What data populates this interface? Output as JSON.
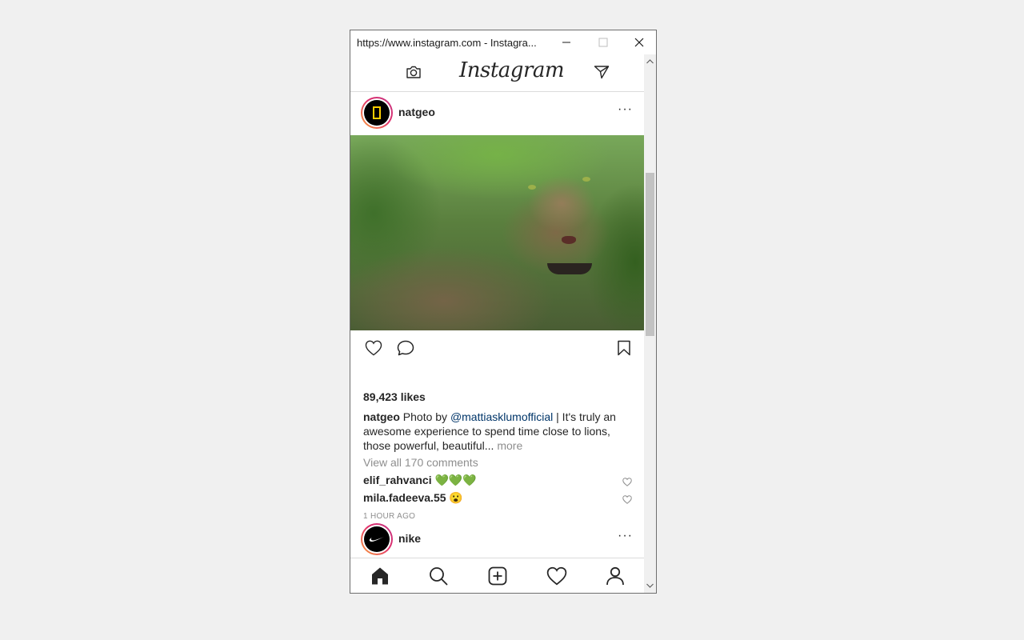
{
  "window": {
    "title": "https://www.instagram.com - Instagra...",
    "min_label": "–",
    "max_label": "□",
    "close_label": "✕"
  },
  "header": {
    "logo": "Instagram"
  },
  "post": {
    "username": "natgeo",
    "more": "···",
    "likes": "89,423 likes",
    "caption_user": "natgeo",
    "caption_pre": " Photo by ",
    "caption_mention": "@mattiasklumofficial",
    "caption_post": " | It's truly an awesome experience to spend time close to lions, those powerful, beautiful... ",
    "caption_more": "more",
    "view_all_comments": "View all 170 comments",
    "comments": [
      {
        "user": "elif_rahvanci",
        "text": " 💚💚💚"
      },
      {
        "user": "mila.fadeeva.55",
        "text": " 😮"
      }
    ],
    "timestamp": "1 HOUR AGO"
  },
  "next_post": {
    "username": "nike",
    "more": "···"
  },
  "colors": {
    "ring_start": "#f9a13c",
    "ring_end": "#c13584",
    "mention": "#003569",
    "muted": "#8e8e8e"
  }
}
